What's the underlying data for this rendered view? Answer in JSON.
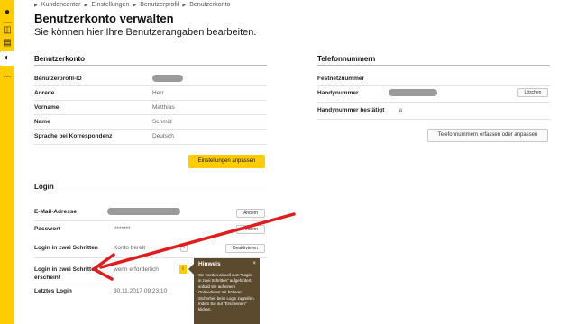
{
  "sidebar": {
    "icons": [
      "user-icon",
      "briefcase-icon",
      "book-icon",
      "speedometer-icon"
    ],
    "more": "···"
  },
  "breadcrumb": [
    "Kundencenter",
    "Einstellungen",
    "Benutzerprofil",
    "Benutzerkonto"
  ],
  "header": {
    "title": "Benutzerkonto verwalten",
    "subtitle": "Sie können hier Ihre Benutzerangaben bearbeiten."
  },
  "account": {
    "title": "Benutzerkonto",
    "rows": [
      {
        "label": "Benutzerprofil-ID",
        "value": ""
      },
      {
        "label": "Anrede",
        "value": "Herr"
      },
      {
        "label": "Vorname",
        "value": "Matthias"
      },
      {
        "label": "Name",
        "value": "Schmid"
      },
      {
        "label": "Sprache bei Korrespondenz",
        "value": "Deutsch"
      }
    ],
    "button": "Einstellungen anpassen"
  },
  "phone": {
    "title": "Telefonnummern",
    "rows": [
      {
        "label": "Festnetznummer",
        "value": ""
      },
      {
        "label": "Handynummer",
        "value": ""
      },
      {
        "label": "Handynummer bestätigt",
        "value": "ja"
      }
    ],
    "delete_button": "Löschen",
    "manage_button": "Telefonnummern erfassen oder anpassen"
  },
  "login": {
    "title": "Login",
    "email_label": "E-Mail-Adresse",
    "email_button": "Ändern",
    "password_label": "Passwort",
    "password_value": "*******",
    "password_button": "Ändern",
    "twostep_label": "Login in zwei Schritten",
    "twostep_value": "Konto bereit",
    "twostep_info": "i",
    "twostep_button": "Deaktivieren",
    "appears_label_1": "Login in zwei Schritten",
    "appears_label_2": "erscheint",
    "appears_value": "wenn erforderlich",
    "appears_info": "i",
    "last_login_label": "Letztes Login",
    "last_login_value": "30.11.2017 09:23:10"
  },
  "tooltip": {
    "title": "Hinweis",
    "close": "×",
    "body": "Sie werden aktuell zum \"Login in zwei Schritten\" aufgefordert, sobald Sie auf einem Onlinedienst mit höherer Sicherheit beim Login zugreifen. Indem Sie auf \"Erscheinen\" klicken,"
  },
  "colors": {
    "accent": "#ffcc00",
    "tooltip_bg": "#5c4a2e",
    "annotation": "#e31b1b"
  }
}
